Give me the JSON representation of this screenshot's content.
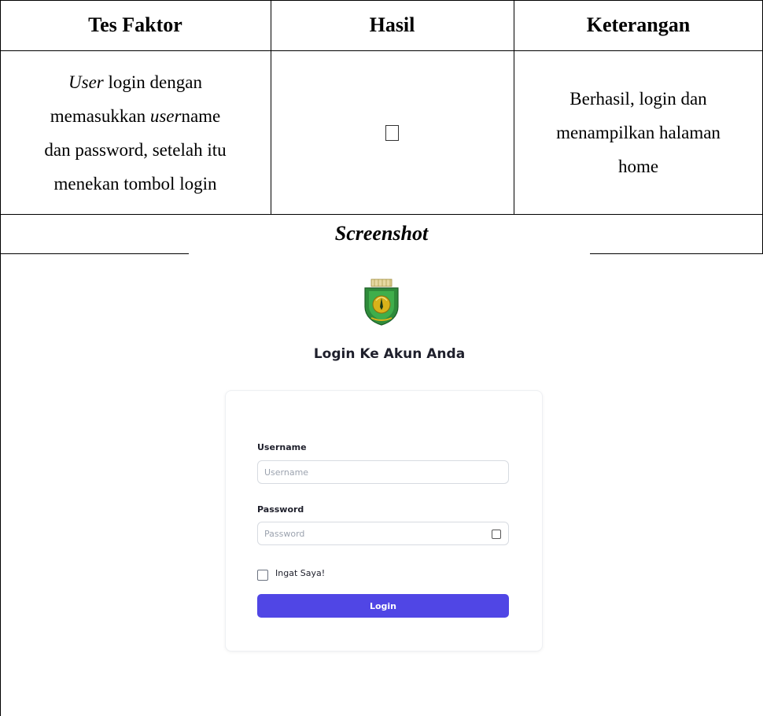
{
  "table": {
    "headers": {
      "test_factor": "Tes Faktor",
      "result": "Hasil",
      "description": "Keterangan"
    },
    "row": {
      "test_factor_lines": [
        [
          {
            "text": "User",
            "italic": true
          },
          {
            "text": " login dengan",
            "italic": false
          }
        ],
        [
          {
            "text": "memasukkan ",
            "italic": false
          },
          {
            "text": "user",
            "italic": true
          },
          {
            "text": "name",
            "italic": false
          }
        ],
        [
          {
            "text": "dan password, setelah itu",
            "italic": false
          }
        ],
        [
          {
            "text": "menekan tombol login",
            "italic": false
          }
        ]
      ],
      "result_symbol": "checkbox-glyph",
      "description_lines": [
        "Berhasil, login dan",
        "menampilkan halaman",
        "home"
      ]
    },
    "screenshot_heading": "Screenshot"
  },
  "screenshot": {
    "logo_icon": "regional-emblem-icon",
    "title": "Login Ke Akun Anda",
    "username_label": "Username",
    "username_placeholder": "Username",
    "password_label": "Password",
    "password_placeholder": "Password",
    "password_toggle_icon": "eye-icon",
    "remember_label": "Ingat Saya!",
    "login_button": "Login",
    "colors": {
      "button": "#5046e5",
      "title": "#1e1f2b",
      "emblem_green": "#2e8b3a",
      "emblem_gold": "#d9b21a"
    }
  }
}
